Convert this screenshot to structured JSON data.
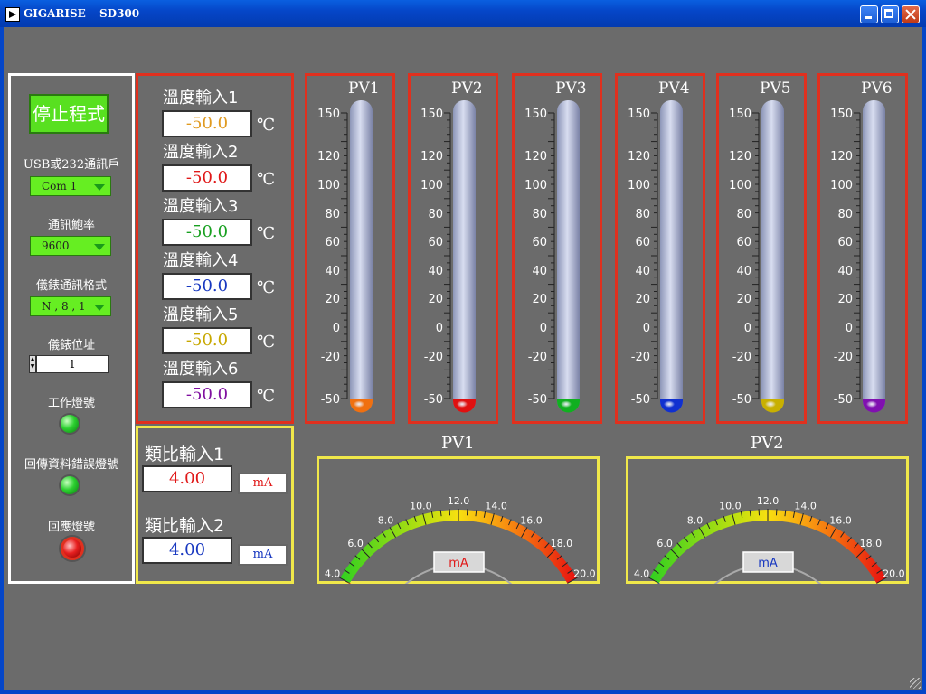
{
  "window": {
    "title_app": "GIGARISE",
    "title_model": "SD300"
  },
  "left_panel": {
    "stop_button": "停止程式",
    "port_label": "USB或232通訊戶",
    "port_value": "Com 1",
    "baud_label": "通訊鮑率",
    "baud_value": "9600",
    "format_label": "儀錶通訊格式",
    "format_value": "N , 8 , 1",
    "address_label": "儀錶位址",
    "address_value": "1",
    "work_led_label": "工作燈號",
    "error_led_label": "回傳資料錯誤燈號",
    "response_led_label": "回應燈號"
  },
  "temp_inputs": [
    {
      "label": "溫度輸入1",
      "value": "-50.0",
      "unit": "℃",
      "color": "#e09a20"
    },
    {
      "label": "溫度輸入2",
      "value": "-50.0",
      "unit": "℃",
      "color": "#e01818"
    },
    {
      "label": "溫度輸入3",
      "value": "-50.0",
      "unit": "℃",
      "color": "#18a020"
    },
    {
      "label": "溫度輸入4",
      "value": "-50.0",
      "unit": "℃",
      "color": "#1838c0"
    },
    {
      "label": "溫度輸入5",
      "value": "-50.0",
      "unit": "℃",
      "color": "#c8a800"
    },
    {
      "label": "溫度輸入6",
      "value": "-50.0",
      "unit": "℃",
      "color": "#8010a0"
    }
  ],
  "analog_inputs": [
    {
      "label": "類比輸入1",
      "value": "4.00",
      "unit": "mA",
      "color": "#e01818"
    },
    {
      "label": "類比輸入2",
      "value": "4.00",
      "unit": "mA",
      "color": "#1838c0"
    }
  ],
  "thermometers": {
    "ticks": [
      "150",
      "120",
      "100",
      "80",
      "60",
      "40",
      "20",
      "0",
      "-20",
      "-50"
    ],
    "items": [
      {
        "name": "PV1",
        "value": -50,
        "color": "#f07010"
      },
      {
        "name": "PV2",
        "value": -50,
        "color": "#e01010"
      },
      {
        "name": "PV3",
        "value": -50,
        "color": "#10b020"
      },
      {
        "name": "PV4",
        "value": -50,
        "color": "#1030d0"
      },
      {
        "name": "PV5",
        "value": -50,
        "color": "#c8b000"
      },
      {
        "name": "PV6",
        "value": -50,
        "color": "#8010b0"
      }
    ]
  },
  "gauges": [
    {
      "name": "PV1",
      "unit": "mA",
      "value": 4.0,
      "needle_color": "#e01818",
      "unit_color": "#e01818",
      "ticks": [
        "4.0",
        "6.0",
        "8.0",
        "10.0",
        "12.0",
        "14.0",
        "16.0",
        "18.0",
        "20.0"
      ]
    },
    {
      "name": "PV2",
      "unit": "mA",
      "value": 4.0,
      "needle_color": "#1838d0",
      "unit_color": "#1838c0",
      "ticks": [
        "4.0",
        "6.0",
        "8.0",
        "10.0",
        "12.0",
        "14.0",
        "16.0",
        "18.0",
        "20.0"
      ]
    }
  ]
}
